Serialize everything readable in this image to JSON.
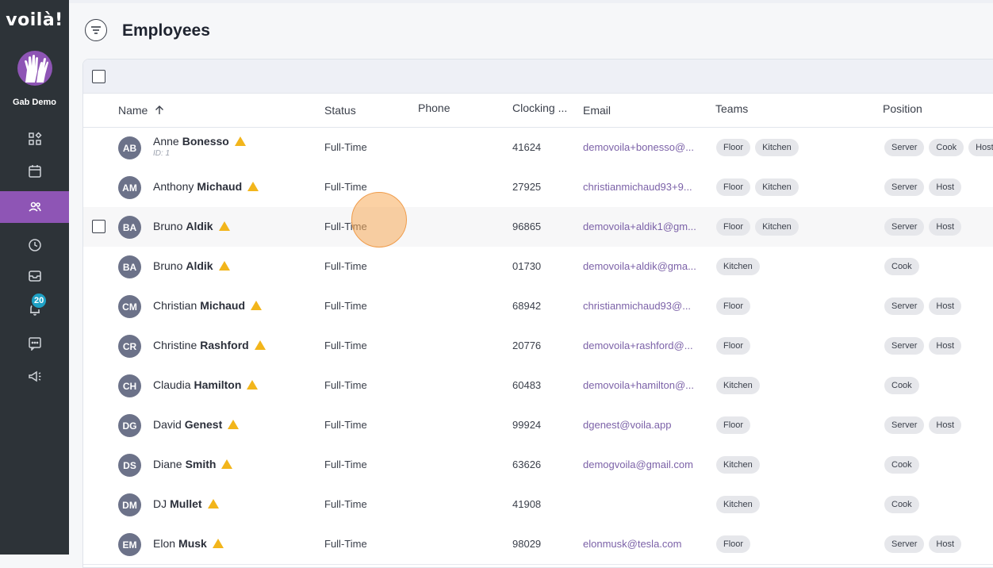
{
  "app": {
    "logo": "voilà!",
    "org_name": "Gab Demo",
    "notification_count": "20"
  },
  "nav": [
    {
      "icon": "dashboard-icon"
    },
    {
      "icon": "calendar-icon"
    },
    {
      "icon": "people-icon",
      "active": true
    },
    {
      "icon": "clock-icon"
    },
    {
      "icon": "inbox-icon"
    },
    {
      "icon": "bell-icon"
    },
    {
      "icon": "chat-icon"
    },
    {
      "icon": "megaphone-icon"
    }
  ],
  "page": {
    "title": "Employees"
  },
  "table": {
    "columns": {
      "name": "Name",
      "status": "Status",
      "phone": "Phone",
      "clocking": "Clocking ...",
      "email": "Email",
      "teams": "Teams",
      "position": "Position"
    },
    "rows": [
      {
        "initials": "AB",
        "first": "Anne",
        "last": "Bonesso",
        "id_label": "ID: 1",
        "status": "Full-Time",
        "clocking": "41624",
        "email": "demovoila+bonesso@...",
        "teams": [
          "Floor",
          "Kitchen"
        ],
        "positions": [
          "Server",
          "Cook",
          "Host"
        ]
      },
      {
        "initials": "AM",
        "first": "Anthony",
        "last": "Michaud",
        "status": "Full-Time",
        "clocking": "27925",
        "email": "christianmichaud93+9...",
        "teams": [
          "Floor",
          "Kitchen"
        ],
        "positions": [
          "Server",
          "Host"
        ]
      },
      {
        "initials": "BA",
        "first": "Bruno",
        "last": "Aldik",
        "status": "Full-Time",
        "clocking": "96865",
        "email": "demovoila+aldik1@gm...",
        "teams": [
          "Floor",
          "Kitchen"
        ],
        "positions": [
          "Server",
          "Host"
        ]
      },
      {
        "initials": "BA",
        "first": "Bruno",
        "last": "Aldik",
        "status": "Full-Time",
        "clocking": "01730",
        "email": "demovoila+aldik@gma...",
        "teams": [
          "Kitchen"
        ],
        "positions": [
          "Cook"
        ]
      },
      {
        "initials": "CM",
        "first": "Christian",
        "last": "Michaud",
        "status": "Full-Time",
        "clocking": "68942",
        "email": "christianmichaud93@...",
        "teams": [
          "Floor"
        ],
        "positions": [
          "Server",
          "Host"
        ]
      },
      {
        "initials": "CR",
        "first": "Christine",
        "last": "Rashford",
        "status": "Full-Time",
        "clocking": "20776",
        "email": "demovoila+rashford@...",
        "teams": [
          "Floor"
        ],
        "positions": [
          "Server",
          "Host"
        ]
      },
      {
        "initials": "CH",
        "first": "Claudia",
        "last": "Hamilton",
        "status": "Full-Time",
        "clocking": "60483",
        "email": "demovoila+hamilton@...",
        "teams": [
          "Kitchen"
        ],
        "positions": [
          "Cook"
        ]
      },
      {
        "initials": "DG",
        "first": "David",
        "last": "Genest",
        "status": "Full-Time",
        "clocking": "99924",
        "email": "dgenest@voila.app",
        "teams": [
          "Floor"
        ],
        "positions": [
          "Server",
          "Host"
        ]
      },
      {
        "initials": "DS",
        "first": "Diane",
        "last": "Smith",
        "status": "Full-Time",
        "clocking": "63626",
        "email": "demogvoila@gmail.com",
        "teams": [
          "Kitchen"
        ],
        "positions": [
          "Cook"
        ]
      },
      {
        "initials": "DM",
        "first": "DJ",
        "last": "Mullet",
        "status": "Full-Time",
        "clocking": "41908",
        "email": "",
        "teams": [
          "Kitchen"
        ],
        "positions": [
          "Cook"
        ]
      },
      {
        "initials": "EM",
        "first": "Elon",
        "last": "Musk",
        "status": "Full-Time",
        "clocking": "98029",
        "email": "elonmusk@tesla.com",
        "teams": [
          "Floor"
        ],
        "positions": [
          "Server",
          "Host"
        ]
      }
    ]
  },
  "colors": {
    "sidebar": "#2d3338",
    "accent": "#8e55b5",
    "badge": "#1ea0c4",
    "warning": "#f2b51b"
  }
}
